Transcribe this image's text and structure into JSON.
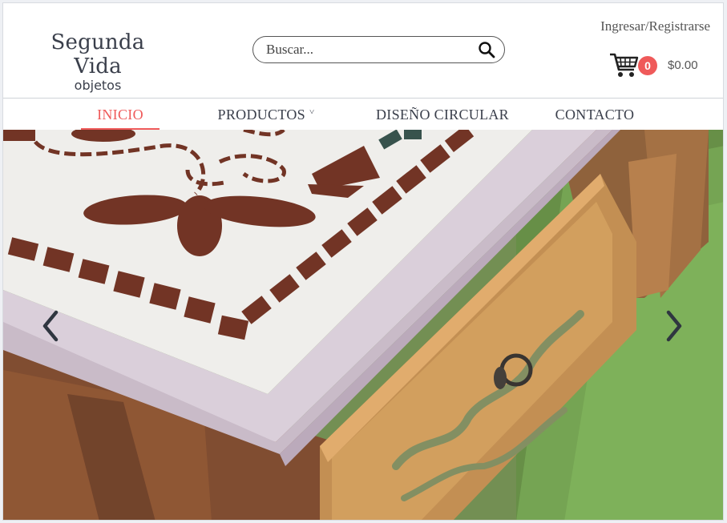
{
  "brand": {
    "title": "Segunda Vida",
    "subtitle": "objetos"
  },
  "search": {
    "placeholder": "Buscar...",
    "value": "",
    "icon": "search-icon"
  },
  "account": {
    "login_label": "Ingresar/Registrarse"
  },
  "cart": {
    "icon": "cart-icon",
    "count": "0",
    "total": "$0.00",
    "badge_color": "#ef5a5a"
  },
  "nav": {
    "items": [
      {
        "label": "INICIO",
        "active": true
      },
      {
        "label": "PRODUCTOS",
        "caret": "˅"
      },
      {
        "label": "DISEÑO CIRCULAR"
      },
      {
        "label": "CONTACTO"
      }
    ],
    "accent": "#ef5a5a"
  },
  "slider": {
    "prev_icon": "chevron-left-icon",
    "next_icon": "chevron-right-icon",
    "image_description_icon": "furniture-photo"
  }
}
